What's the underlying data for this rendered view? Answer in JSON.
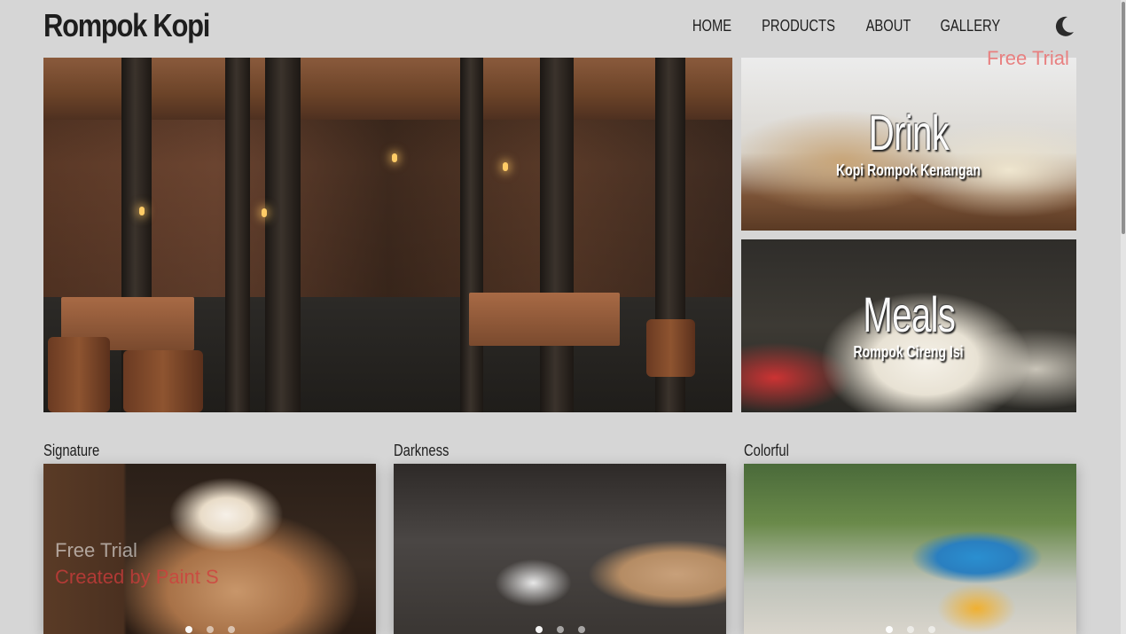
{
  "brand": {
    "name": "Rompok Kopi"
  },
  "nav": {
    "items": [
      {
        "label": "HOME"
      },
      {
        "label": "PRODUCTS"
      },
      {
        "label": "ABOUT"
      },
      {
        "label": "GALLERY"
      }
    ],
    "theme_toggle_icon": "moon-icon"
  },
  "cards": {
    "drink": {
      "title": "Drink",
      "subtitle": "Kopi Rompok Kenangan"
    },
    "meals": {
      "title": "Meals",
      "subtitle": "Rompok Cireng Isi"
    }
  },
  "categories": [
    {
      "label": "Signature",
      "slides": 3,
      "active": 0
    },
    {
      "label": "Darkness",
      "slides": 3,
      "active": 0
    },
    {
      "label": "Colorful",
      "slides": 3,
      "active": 0
    }
  ],
  "watermarks": {
    "top_right": "Free Trial",
    "bottom_line1": "Free Trial",
    "bottom_line2": "Created by Paint S"
  },
  "colors": {
    "background": "#d6d6d6",
    "text": "#1e1e1e",
    "watermark_red": "#e05050"
  }
}
